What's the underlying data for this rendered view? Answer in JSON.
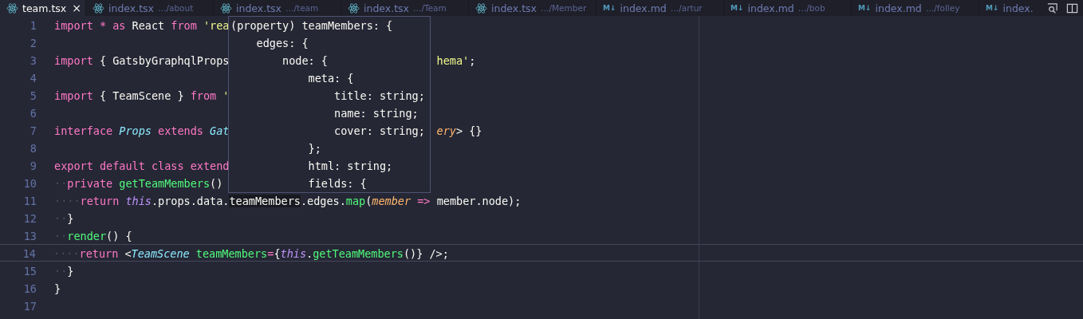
{
  "tabs": [
    {
      "name": "team.tsx",
      "kind": "tsx",
      "selected": true,
      "close": "×"
    },
    {
      "name": "index.tsx",
      "path": "…/about",
      "kind": "tsx",
      "selected": false
    },
    {
      "name": "index.tsx",
      "path": "…/team",
      "kind": "tsx",
      "selected": false
    },
    {
      "name": "index.tsx",
      "path": "…/Team",
      "kind": "tsx",
      "selected": false
    },
    {
      "name": "index.tsx",
      "path": "…/Member",
      "kind": "tsx",
      "selected": false
    },
    {
      "name": "index.md",
      "path": "…/artur",
      "kind": "md",
      "badge": "M↓",
      "selected": false
    },
    {
      "name": "index.md",
      "path": "…/bob",
      "kind": "md",
      "badge": "M↓",
      "selected": false
    },
    {
      "name": "index.md",
      "path": "…/folley",
      "kind": "md",
      "badge": "M↓",
      "selected": false
    },
    {
      "name": "index.",
      "kind": "md",
      "badge": "M↓",
      "selected": false
    }
  ],
  "lines": [
    {
      "number": "1",
      "current": false,
      "tokens": [
        {
          "text": "import ",
          "kind": "keyword"
        },
        {
          "text": "* ",
          "kind": "keyword"
        },
        {
          "text": "as ",
          "kind": "keyword"
        },
        {
          "text": "React",
          "kind": "plain"
        },
        {
          "text": " from ",
          "kind": "keyword"
        },
        {
          "text": "'rea",
          "kind": "string"
        }
      ]
    },
    {
      "number": "2",
      "current": false
    },
    {
      "number": "3",
      "current": false,
      "tokens": [
        {
          "text": "import ",
          "kind": "keyword"
        },
        {
          "text": "{ GatsbyGraphqlProps",
          "kind": "plain"
        }
      ],
      "tail": [
        {
          "text": "hema'",
          "kind": "string"
        },
        {
          "text": ";",
          "kind": "plain"
        }
      ]
    },
    {
      "number": "4",
      "current": false
    },
    {
      "number": "5",
      "current": false,
      "tokens": [
        {
          "text": "import ",
          "kind": "keyword"
        },
        {
          "text": "{ TeamScene } ",
          "kind": "plain"
        },
        {
          "text": "from ",
          "kind": "keyword"
        },
        {
          "text": "'",
          "kind": "string"
        }
      ]
    },
    {
      "number": "6",
      "current": false
    },
    {
      "number": "7",
      "current": false,
      "tokens": [
        {
          "text": "interface ",
          "kind": "keyword"
        },
        {
          "text": "Props ",
          "kind": "class"
        },
        {
          "text": "extends ",
          "kind": "keyword"
        },
        {
          "text": "Gat",
          "kind": "class"
        }
      ],
      "tail": [
        {
          "text": "ery",
          "kind": "param"
        },
        {
          "text": "> {}",
          "kind": "plain"
        }
      ]
    },
    {
      "number": "8",
      "current": false
    },
    {
      "number": "9",
      "current": false,
      "tokens": [
        {
          "text": "export default class extend",
          "kind": "keyword"
        }
      ]
    },
    {
      "number": "10",
      "current": false,
      "tokens": [
        {
          "text": "··",
          "kind": "whitespace"
        },
        {
          "text": "private ",
          "kind": "keyword"
        },
        {
          "text": "getTeamMembers",
          "kind": "function"
        },
        {
          "text": "()",
          "kind": "plain"
        }
      ]
    },
    {
      "number": "11",
      "current": false,
      "tokens": [
        {
          "text": "····",
          "kind": "whitespace"
        },
        {
          "text": "return ",
          "kind": "keyword"
        },
        {
          "text": "this",
          "kind": "this"
        },
        {
          "text": ".props.data.",
          "kind": "plain"
        },
        {
          "text": "teamMembers",
          "kind": "highlight"
        },
        {
          "text": ".edges.",
          "kind": "plain"
        },
        {
          "text": "map",
          "kind": "function"
        },
        {
          "text": "(",
          "kind": "plain"
        },
        {
          "text": "member ",
          "kind": "param"
        },
        {
          "text": "=> ",
          "kind": "keyword"
        },
        {
          "text": "member.node);",
          "kind": "plain"
        }
      ]
    },
    {
      "number": "12",
      "current": false,
      "tokens": [
        {
          "text": "··",
          "kind": "whitespace"
        },
        {
          "text": "}",
          "kind": "plain"
        }
      ]
    },
    {
      "number": "13",
      "current": false,
      "tokens": [
        {
          "text": "··",
          "kind": "whitespace"
        },
        {
          "text": "render",
          "kind": "function"
        },
        {
          "text": "() {",
          "kind": "plain"
        }
      ]
    },
    {
      "number": "14",
      "current": true,
      "tokens": [
        {
          "text": "····",
          "kind": "whitespace"
        },
        {
          "text": "return ",
          "kind": "keyword"
        },
        {
          "text": "<",
          "kind": "plain"
        },
        {
          "text": "TeamScene ",
          "kind": "class"
        },
        {
          "text": "teamMembers",
          "kind": "function"
        },
        {
          "text": "=",
          "kind": "keyword"
        },
        {
          "text": "{",
          "kind": "plain"
        },
        {
          "text": "this",
          "kind": "this"
        },
        {
          "text": ".",
          "kind": "plain"
        },
        {
          "text": "getTeamMembers",
          "kind": "function"
        },
        {
          "text": "()} />;",
          "kind": "plain"
        }
      ]
    },
    {
      "number": "15",
      "current": false,
      "tokens": [
        {
          "text": "··",
          "kind": "whitespace"
        },
        {
          "text": "}",
          "kind": "plain"
        }
      ]
    },
    {
      "number": "16",
      "current": false,
      "tokens": [
        {
          "text": "}",
          "kind": "plain"
        }
      ]
    },
    {
      "number": "17",
      "current": false
    }
  ],
  "tooltip": {
    "lines": [
      "(property) teamMembers: {",
      "    edges: {",
      "        node: {",
      "            meta: {",
      "                title: string;",
      "                name: string;",
      "                cover: string;",
      "            };",
      "            html: string;",
      "            fields: {"
    ]
  }
}
